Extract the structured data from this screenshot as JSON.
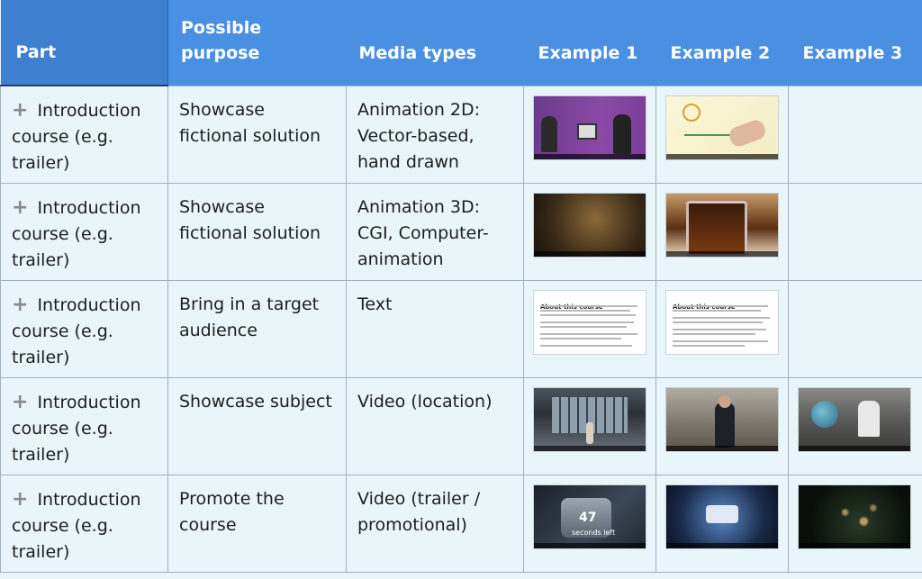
{
  "table": {
    "headers": {
      "part": "Part",
      "purpose": "Possible purpose",
      "media": "Media types",
      "ex1": "Example 1",
      "ex2": "Example 2",
      "ex3": "Example 3"
    },
    "rows": [
      {
        "part": "Introduction course (e.g. trailer)",
        "purpose": "Showcase fictional solution",
        "media": "Animation 2D: Vector-based, hand drawn",
        "examples": [
          "purple-animation-thumbnail",
          "whiteboard-drawing-thumbnail"
        ]
      },
      {
        "part": "Introduction course (e.g. trailer)",
        "purpose": "Showcase fictional solution",
        "media": "Animation 3D: CGI, Computer-animation",
        "examples": [
          "cgi-equation-thumbnail",
          "beer-mug-thumbnail"
        ]
      },
      {
        "part": "Introduction course (e.g. trailer)",
        "purpose": "Bring in a target audience",
        "media": "Text",
        "examples": [
          "about-this-course-text-thumbnail",
          "about-this-course-text-thumbnail"
        ],
        "thumb_heading": "About this course"
      },
      {
        "part": "Introduction course (e.g. trailer)",
        "purpose": "Showcase subject",
        "media": "Video (location)",
        "examples": [
          "office-building-thumbnail",
          "hangar-presenter-thumbnail",
          "factory-globe-thumbnail"
        ]
      },
      {
        "part": "Introduction course (e.g. trailer)",
        "purpose": "Promote the course",
        "media": "Video (trailer / promotional)",
        "examples": [
          "smartwatch-thumbnail",
          "blue-device-thumbnail",
          "earth-night-thumbnail"
        ],
        "watch_number": "47",
        "watch_caption": "seconds left"
      }
    ],
    "plus_glyph": "+"
  },
  "colors": {
    "header_bg": "#4a90e2",
    "body_bg": "#e9f6f9",
    "border": "#9fb3bb"
  }
}
